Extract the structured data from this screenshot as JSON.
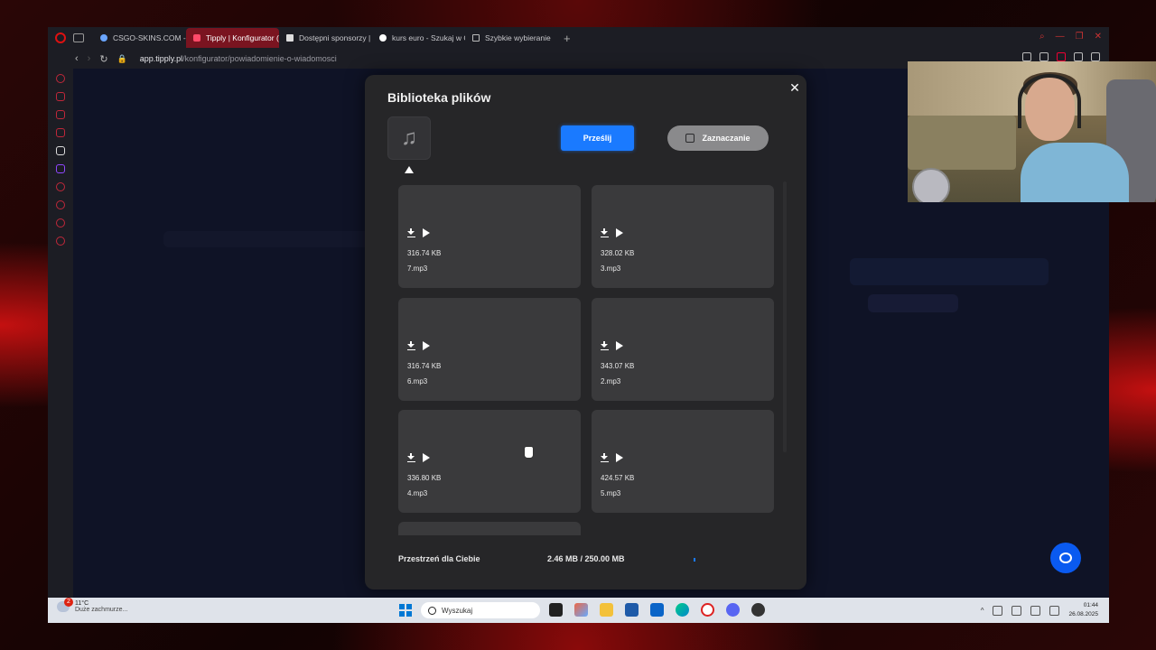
{
  "browser": {
    "tabs": [
      {
        "label": "CSGO-SKINS.COM - Naj",
        "active": false
      },
      {
        "label": "Tipply | Konfigurator (Pov",
        "active": true
      },
      {
        "label": "Dostępni sponsorzy | inS",
        "active": false
      },
      {
        "label": "kurs euro - Szukaj w Goo",
        "active": false
      },
      {
        "label": "Szybkie wybieranie",
        "active": false
      }
    ],
    "url_domain": "app.tipply.pl",
    "url_path": "/konfigurator/powiadomienie-o-wiadomosci",
    "accent_color": "#7a1420"
  },
  "modal": {
    "title": "Biblioteka plików",
    "upload_label": "Prześlij",
    "select_label": "Zaznaczanie",
    "files": [
      {
        "size": "316.74 KB",
        "name": "7.mp3"
      },
      {
        "size": "328.02 KB",
        "name": "3.mp3"
      },
      {
        "size": "316.74 KB",
        "name": "6.mp3"
      },
      {
        "size": "343.07 KB",
        "name": "2.mp3"
      },
      {
        "size": "336.80 KB",
        "name": "4.mp3"
      },
      {
        "size": "424.57 KB",
        "name": "5.mp3"
      }
    ],
    "storage_label": "Przestrzeń dla Ciebie",
    "storage_value": "2.46 MB / 250.00 MB",
    "storage_fraction": 0.0098,
    "accent_color": "#1a7aff"
  },
  "taskbar": {
    "weather_temp": "11°C",
    "weather_desc": "Duże zachmurze...",
    "weather_badge": "2",
    "search_placeholder": "Wyszukaj",
    "time": "01:44",
    "date": "26.08.2025"
  }
}
